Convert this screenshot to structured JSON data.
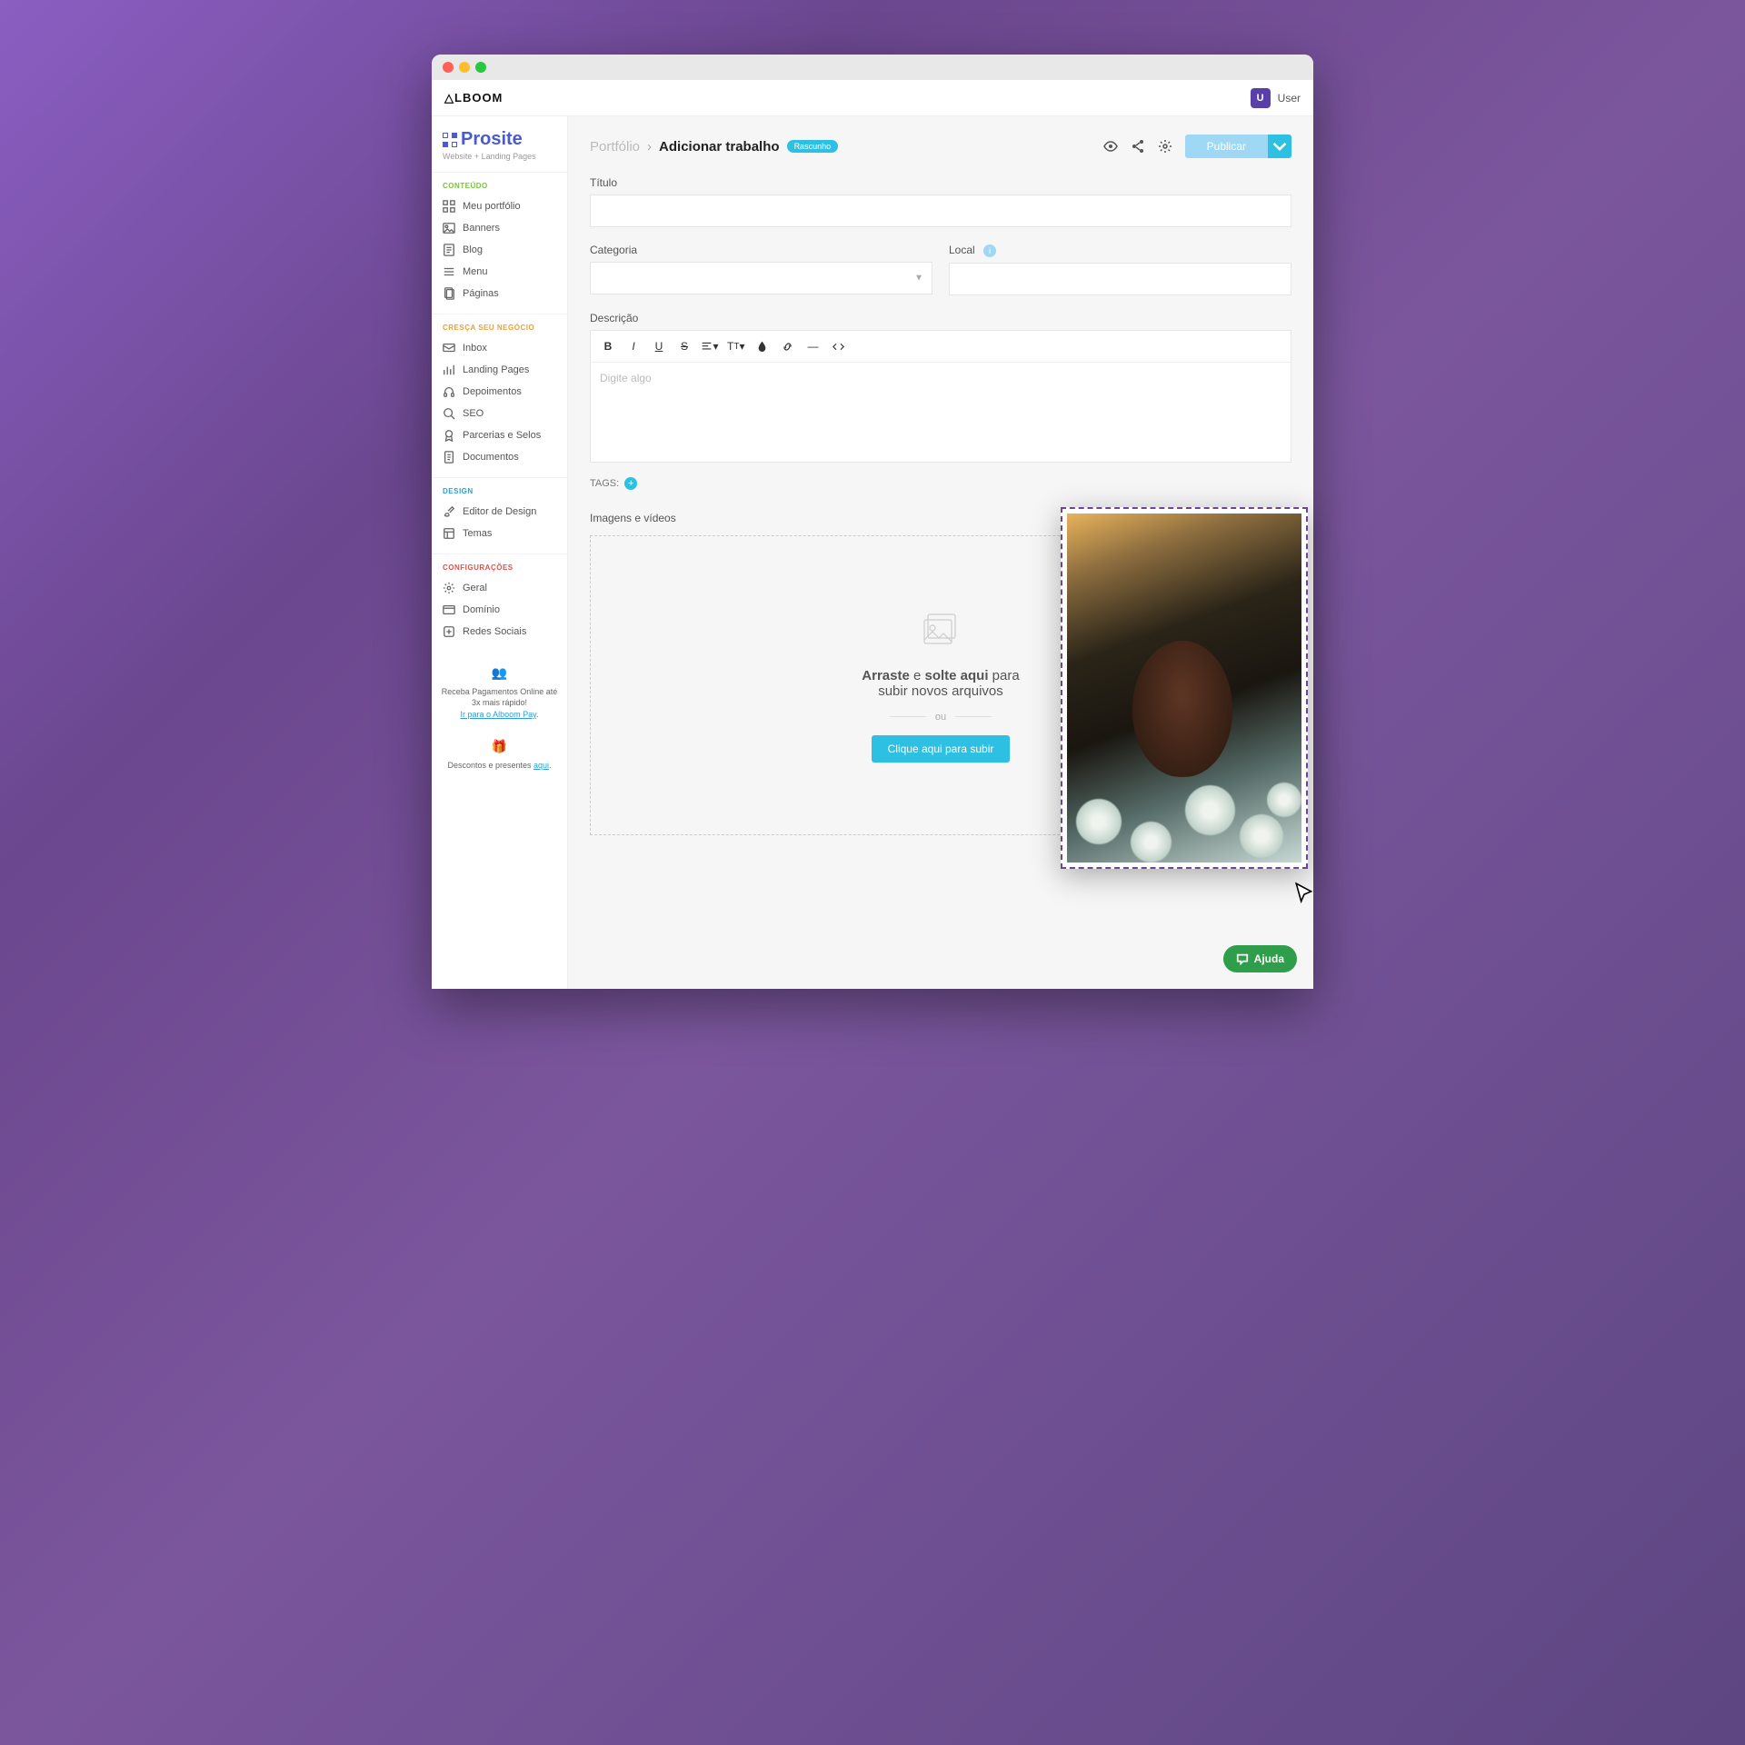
{
  "topbar": {
    "brand": "△LBOOM",
    "user_initial": "U",
    "user_label": "User"
  },
  "sidebar": {
    "product_name": "Prosite",
    "product_subtitle": "Website + Landing Pages",
    "sections": [
      {
        "title": "CONTEÚDO",
        "color": "t-green",
        "items": [
          {
            "label": "Meu portfólio",
            "icon": "grid-icon"
          },
          {
            "label": "Banners",
            "icon": "image-icon"
          },
          {
            "label": "Blog",
            "icon": "doc-icon"
          },
          {
            "label": "Menu",
            "icon": "menu-icon"
          },
          {
            "label": "Páginas",
            "icon": "pages-icon"
          }
        ]
      },
      {
        "title": "CRESÇA SEU NEGÓCIO",
        "color": "t-orange",
        "items": [
          {
            "label": "Inbox",
            "icon": "inbox-icon"
          },
          {
            "label": "Landing Pages",
            "icon": "chart-icon"
          },
          {
            "label": "Depoimentos",
            "icon": "headset-icon"
          },
          {
            "label": "SEO",
            "icon": "seo-icon"
          },
          {
            "label": "Parcerias e Selos",
            "icon": "badge-icon"
          },
          {
            "label": "Documentos",
            "icon": "note-icon"
          }
        ]
      },
      {
        "title": "DESIGN",
        "color": "t-blue",
        "items": [
          {
            "label": "Editor de Design",
            "icon": "brush-icon"
          },
          {
            "label": "Temas",
            "icon": "themes-icon"
          }
        ]
      },
      {
        "title": "CONFIGURAÇÕES",
        "color": "t-red",
        "items": [
          {
            "label": "Geral",
            "icon": "gear-icon"
          },
          {
            "label": "Domínio",
            "icon": "domain-icon"
          },
          {
            "label": "Redes Sociais",
            "icon": "social-icon"
          }
        ]
      }
    ],
    "promo1_line": "Receba Pagamentos Online até 3x mais rápido!",
    "promo1_link": "Ir para o Alboom Pay",
    "promo2_line": "Descontos e presentes ",
    "promo2_link": "aqui"
  },
  "header": {
    "crumb_root": "Portfólio",
    "crumb_current": "Adicionar trabalho",
    "status_pill": "Rascunho",
    "publish_label": "Publicar"
  },
  "form": {
    "title_label": "Título",
    "title_value": "",
    "category_label": "Categoria",
    "category_value": "",
    "local_label": "Local",
    "local_value": "",
    "description_label": "Descrição",
    "description_placeholder": "Digite algo",
    "tags_label": "TAGS:",
    "media_label": "Imagens e vídeos"
  },
  "dropzone": {
    "line1_bold1": "Arraste",
    "line1_mid": " e ",
    "line1_bold2": "solte aqui",
    "line1_tail": " para",
    "line2": "subir novos arquivos",
    "or": "ou",
    "upload_button": "Clique aqui para subir"
  },
  "help": {
    "label": "Ajuda"
  }
}
